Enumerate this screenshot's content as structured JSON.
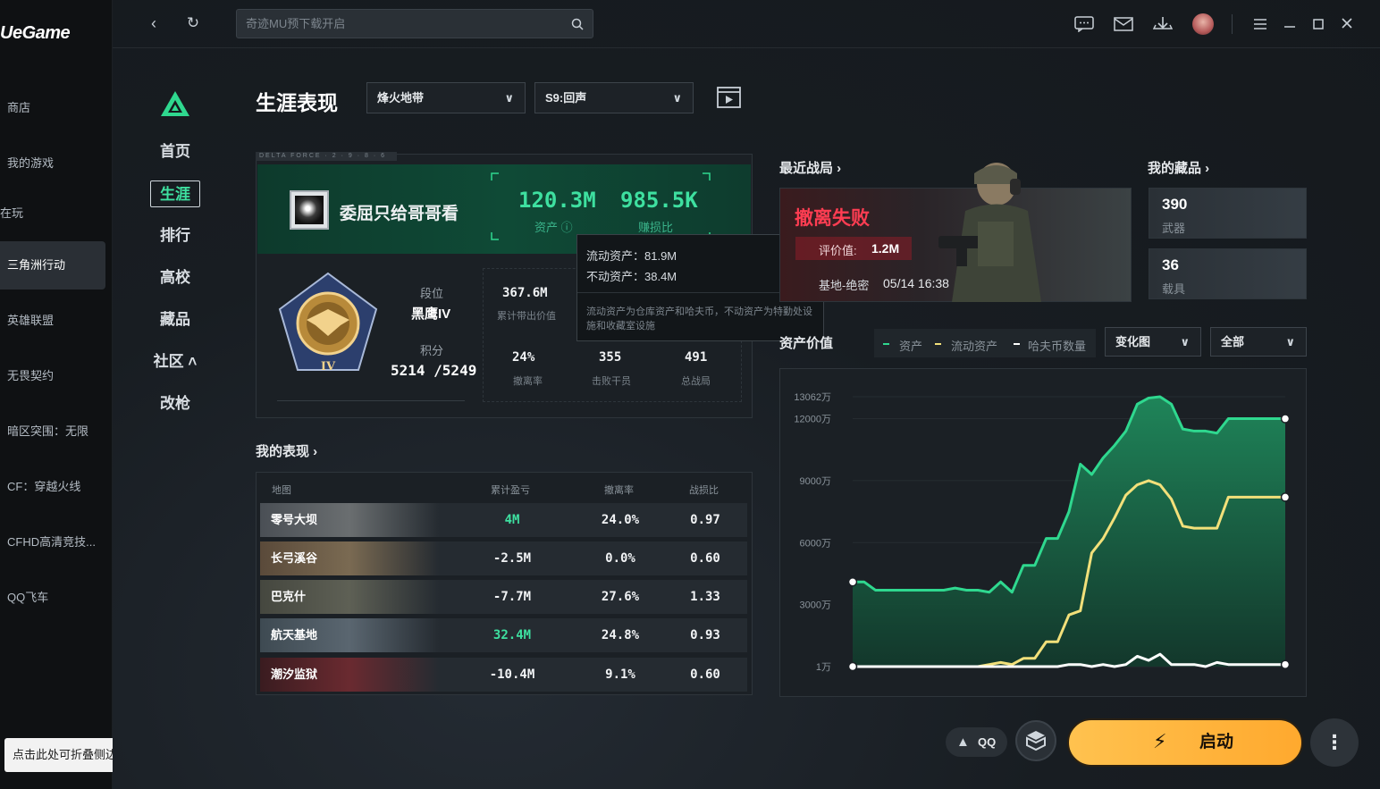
{
  "app": {
    "brand": "UeGame"
  },
  "games": [
    {
      "label": "商店"
    },
    {
      "label": "我的游戏"
    },
    {
      "label": "在玩"
    },
    {
      "label": "三角洲行动"
    },
    {
      "label": "英雄联盟"
    },
    {
      "label": "无畏契约"
    },
    {
      "label": "暗区突围：无限"
    },
    {
      "label": "CF：穿越火线"
    },
    {
      "label": "CFHD高清竞技..."
    },
    {
      "label": "QQ飞车"
    }
  ],
  "collapse_tip": "点击此处可折叠侧边栏",
  "search": {
    "placeholder": "奇迹MU预下载开启"
  },
  "nav": [
    {
      "label": "首页"
    },
    {
      "label": "生涯"
    },
    {
      "label": "排行"
    },
    {
      "label": "高校"
    },
    {
      "label": "藏品"
    },
    {
      "label": "社区 ˄"
    },
    {
      "label": "改枪"
    }
  ],
  "header": {
    "title": "生涯表现",
    "mode_select": "烽火地带",
    "season_select": "S9:回声"
  },
  "card_topline": "DELTA FORCE · 2 · 9 · 8 · 6",
  "profile": {
    "name": "委屈只给哥哥看",
    "assets_value": "120.3M",
    "assets_label": "资产 ⓘ",
    "profit_ratio_value": "985.5K",
    "profit_ratio_label": "赚损比",
    "rank_label": "段位",
    "rank_name": "黑鹰IV",
    "points_label": "积分",
    "points_value": "5214 /5249",
    "stats": [
      {
        "value": "367.6M",
        "label": "累计带出价值"
      },
      {
        "value": "24%",
        "label": "撤离率"
      },
      {
        "value": "355",
        "label": "击败干员"
      },
      {
        "value": "491",
        "label": "总战局"
      }
    ]
  },
  "tooltip": {
    "liquid": "流动资产：81.9M",
    "fixed": "不动资产：38.4M",
    "note": "流动资产为仓库资产和哈夫币，不动资产为特勤处设施和收藏室设施"
  },
  "performance": {
    "title": "我的表现 ›",
    "headers": [
      "地图",
      "累计盈亏",
      "撤离率",
      "战损比"
    ],
    "rows": [
      {
        "map": "零号大坝",
        "profit": "4M",
        "rate": "24.0%",
        "kd": "0.97",
        "positive": true
      },
      {
        "map": "长弓溪谷",
        "profit": "-2.5M",
        "rate": "0.0%",
        "kd": "0.60",
        "positive": false
      },
      {
        "map": "巴克什",
        "profit": "-7.7M",
        "rate": "27.6%",
        "kd": "1.33",
        "positive": false
      },
      {
        "map": "航天基地",
        "profit": "32.4M",
        "rate": "24.8%",
        "kd": "0.93",
        "positive": true
      },
      {
        "map": "潮汐监狱",
        "profit": "-10.4M",
        "rate": "9.1%",
        "kd": "0.60",
        "positive": false
      }
    ]
  },
  "recent": {
    "title": "最近战局 ›",
    "result": "撤离失败",
    "value_label": "评价值:",
    "value": "1.2M",
    "map": "基地-绝密",
    "time": "05/14 16:38"
  },
  "collection": {
    "title": "我的藏品 ›",
    "items": [
      {
        "value": "390",
        "label": "武器"
      },
      {
        "value": "36",
        "label": "载具"
      }
    ]
  },
  "asset_chart": {
    "title": "资产价值",
    "legend": [
      "资产",
      "流动资产",
      "哈夫币数量"
    ],
    "view_select": "变化图",
    "range_select": "全部"
  },
  "chart_data": {
    "type": "area",
    "y_ticks": [
      "13062万",
      "12000万",
      "9000万",
      "6000万",
      "3000万",
      "1万"
    ],
    "ylim": [
      1,
      13062
    ],
    "y_unit": "万",
    "x": [
      0,
      1,
      2,
      3,
      4,
      5,
      6,
      7,
      8,
      9,
      10,
      11,
      12,
      13,
      14,
      15,
      16,
      17,
      18,
      19,
      20,
      21,
      22,
      23,
      24,
      25,
      26,
      27,
      28,
      29,
      30,
      31,
      32,
      33,
      34,
      35,
      36,
      37,
      38
    ],
    "series": [
      {
        "name": "资产",
        "color": "#2fd88f",
        "values": [
          4100,
          4100,
          3700,
          3700,
          3700,
          3700,
          3700,
          3700,
          3700,
          3800,
          3700,
          3700,
          3600,
          4100,
          3600,
          4900,
          4900,
          6200,
          6200,
          7500,
          9800,
          9300,
          10100,
          10700,
          11400,
          12700,
          13000,
          13062,
          12700,
          11500,
          11400,
          11400,
          11300,
          12000,
          12000,
          12000,
          12000,
          12000,
          12000
        ],
        "last_point": 12000
      },
      {
        "name": "流动资产",
        "color": "#f2e07a",
        "values": [
          0,
          0,
          0,
          0,
          0,
          0,
          0,
          0,
          0,
          0,
          0,
          0,
          100,
          200,
          100,
          400,
          400,
          1200,
          1200,
          2500,
          2700,
          5500,
          6200,
          7200,
          8300,
          8800,
          9000,
          8800,
          8100,
          6800,
          6700,
          6700,
          6700,
          8200,
          8200,
          8200,
          8200,
          8200,
          8200
        ],
        "last_point": 8200
      },
      {
        "name": "哈夫币数量",
        "color": "#ffffff",
        "values": [
          0,
          0,
          0,
          0,
          0,
          0,
          0,
          0,
          0,
          0,
          0,
          0,
          0,
          0,
          0,
          0,
          0,
          0,
          0,
          100,
          100,
          0,
          100,
          0,
          100,
          500,
          300,
          600,
          100,
          100,
          100,
          0,
          200,
          100,
          100,
          100,
          100,
          100,
          100
        ],
        "last_point": 100
      }
    ]
  },
  "bottom": {
    "qq_label": "QQ",
    "start_label": "启动"
  }
}
